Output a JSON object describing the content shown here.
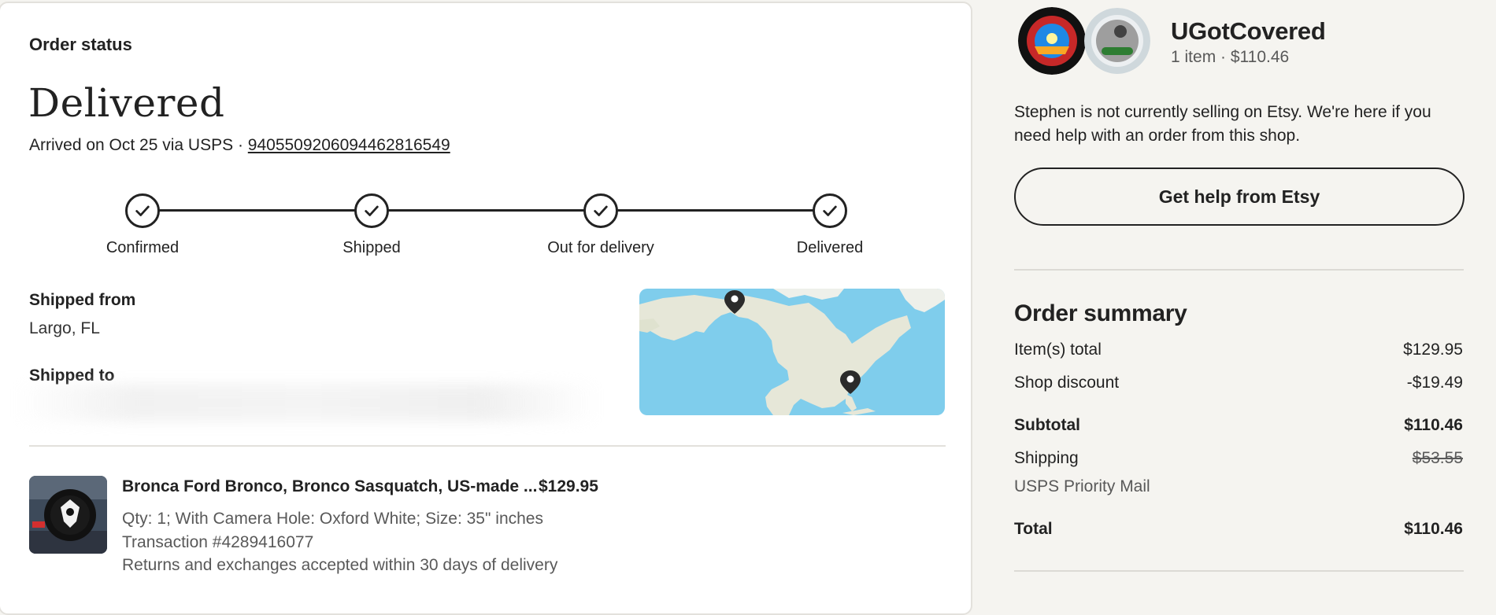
{
  "order": {
    "status_label": "Order status",
    "headline": "Delivered",
    "arrived_text": "Arrived on Oct 25 via USPS · ",
    "tracking_number": "9405509206094462816549",
    "steps": [
      "Confirmed",
      "Shipped",
      "Out for delivery",
      "Delivered"
    ],
    "shipped_from_label": "Shipped from",
    "shipped_from_value": "Largo, FL",
    "shipped_to_label": "Shipped to"
  },
  "item": {
    "title": "Bronca Ford Bronco, Bronco Sasquatch, US-made ...",
    "price": "$129.95",
    "details": "Qty: 1; With Camera Hole: Oxford White; Size: 35\" inches",
    "transaction": "Transaction #4289416077",
    "returns": "Returns and exchanges accepted within 30 days of delivery"
  },
  "shop": {
    "name": "UGotCovered",
    "subtitle": "1 item · $110.46",
    "notice": "Stephen is not currently selling on Etsy. We're here if you need help with an order from this shop.",
    "help_button": "Get help from Etsy"
  },
  "summary": {
    "title": "Order summary",
    "items_total_label": "Item(s) total",
    "items_total_value": "$129.95",
    "discount_label": "Shop discount",
    "discount_value": "-$19.49",
    "subtotal_label": "Subtotal",
    "subtotal_value": "$110.46",
    "shipping_label": "Shipping",
    "shipping_value": "$53.55",
    "shipping_method": "USPS Priority Mail",
    "total_label": "Total",
    "total_value": "$110.46"
  },
  "icons": {
    "step_check": "check-icon",
    "map_pin": "map-pin-icon"
  },
  "colors": {
    "page_background": "#f5f4f0",
    "card_background": "#ffffff",
    "map_water": "#7fcdec",
    "map_land": "#e6e7d8",
    "text_primary": "#222222",
    "text_muted": "#595959"
  }
}
